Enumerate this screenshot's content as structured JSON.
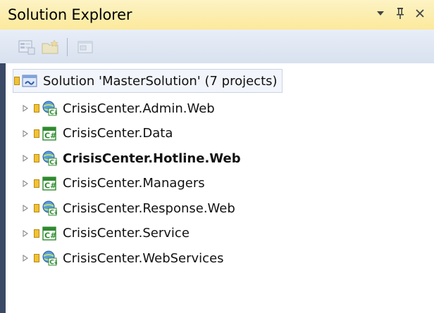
{
  "window": {
    "title": "Solution Explorer"
  },
  "title_buttons": {
    "dropdown_glyph": "▼",
    "pin_glyph": "ᵽ",
    "close_glyph": "✕"
  },
  "toolbar": {
    "items": [
      {
        "icon": "properties-icon"
      },
      {
        "icon": "show-all-files-icon"
      },
      {
        "icon": "view-code-icon"
      }
    ]
  },
  "solution": {
    "label": "Solution 'MasterSolution' (7 projects)",
    "icon": "solution-icon"
  },
  "projects": [
    {
      "label": "CrisisCenter.Admin.Web",
      "type": "web",
      "bold": false
    },
    {
      "label": "CrisisCenter.Data",
      "type": "csharp",
      "bold": false
    },
    {
      "label": "CrisisCenter.Hotline.Web",
      "type": "web",
      "bold": true
    },
    {
      "label": "CrisisCenter.Managers",
      "type": "csharp",
      "bold": false
    },
    {
      "label": "CrisisCenter.Response.Web",
      "type": "web",
      "bold": false
    },
    {
      "label": "CrisisCenter.Service",
      "type": "csharp",
      "bold": false
    },
    {
      "label": "CrisisCenter.WebServices",
      "type": "web",
      "bold": false
    }
  ],
  "colors": {
    "titlebar_top": "#fdf3c4",
    "titlebar_bottom": "#fbe99b",
    "toolbar": "#dde5f2",
    "lock_yellow": "#e8b923",
    "csharp_green": "#2f8a2f",
    "web_blue": "#3d77c8"
  }
}
